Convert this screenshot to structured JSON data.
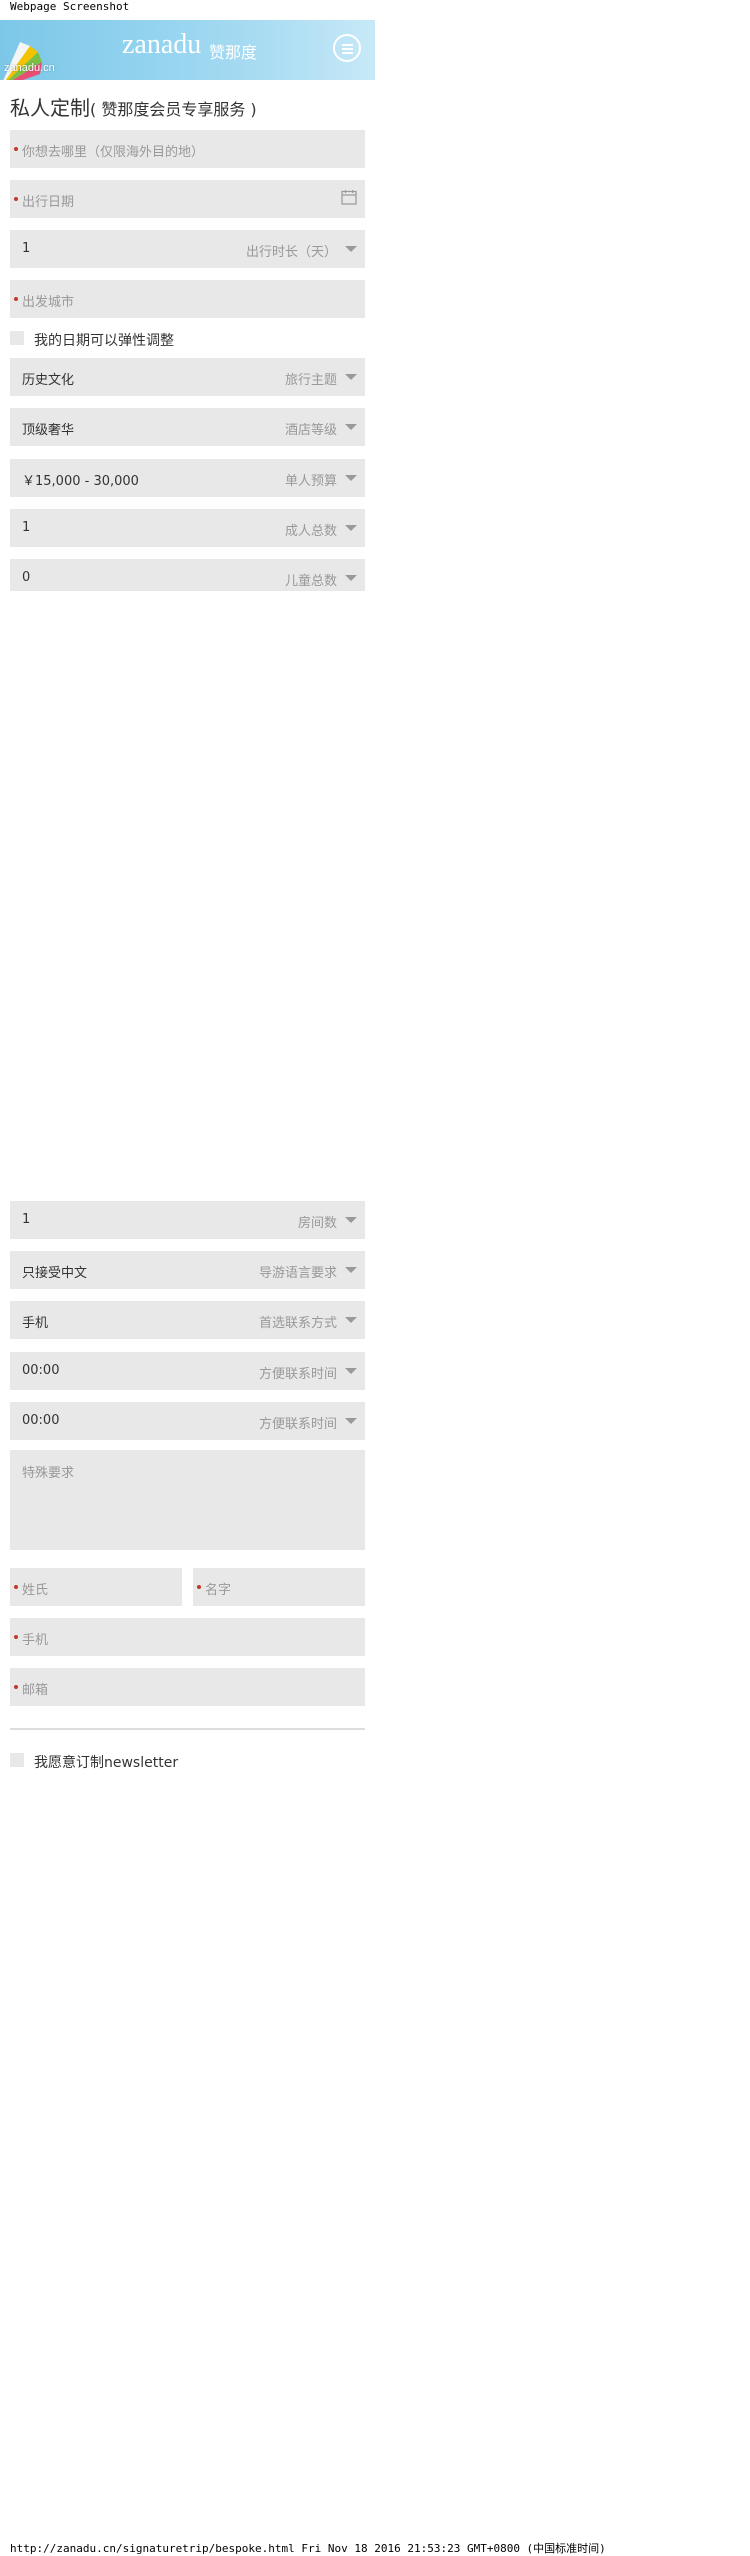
{
  "page_caption": "Webpage Screenshot",
  "header": {
    "brand": "zanadu",
    "brand_cn": "赞那度",
    "logo_text": "zanadu.cn"
  },
  "title": {
    "main": "私人定制",
    "sub": "( 赞那度会员专享服务 )"
  },
  "form": {
    "destination_placeholder": "你想去哪里（仅限海外目的地）",
    "departure_date_placeholder": "出行日期",
    "duration": {
      "value": "1",
      "label": "出行时长（天）"
    },
    "departure_city_placeholder": "出发城市",
    "flexible_dates_label": "我的日期可以弹性调整",
    "theme": {
      "value": "历史文化",
      "label": "旅行主题"
    },
    "hotel_level": {
      "value": "顶级奢华",
      "label": "酒店等级"
    },
    "budget": {
      "value": "￥15,000 - 30,000",
      "label": "单人预算"
    },
    "adults": {
      "value": "1",
      "label": "成人总数"
    },
    "children": {
      "value": "0",
      "label": "儿童总数"
    },
    "rooms": {
      "value": "1",
      "label": "房间数"
    },
    "guide_language": {
      "value": "只接受中文",
      "label": "导游语言要求"
    },
    "contact_method": {
      "value": "手机",
      "label": "首选联系方式"
    },
    "contact_time_start": {
      "value": "00:00",
      "label": "方便联系时间"
    },
    "contact_time_end": {
      "value": "00:00",
      "label": "方便联系时间"
    },
    "special_requests_placeholder": "特殊要求",
    "last_name_placeholder": "姓氏",
    "first_name_placeholder": "名字",
    "phone_placeholder": "手机",
    "email_placeholder": "邮箱",
    "newsletter_label": "我愿意订制newsletter"
  },
  "footer_caption": "http://zanadu.cn/signaturetrip/bespoke.html Fri Nov 18 2016 21:53:23 GMT+0800 (中国标准时间)",
  "colors": {
    "header_blue": "#7cc7e8",
    "field_bg": "#e8e8e8",
    "required_dot": "#c0392b"
  }
}
